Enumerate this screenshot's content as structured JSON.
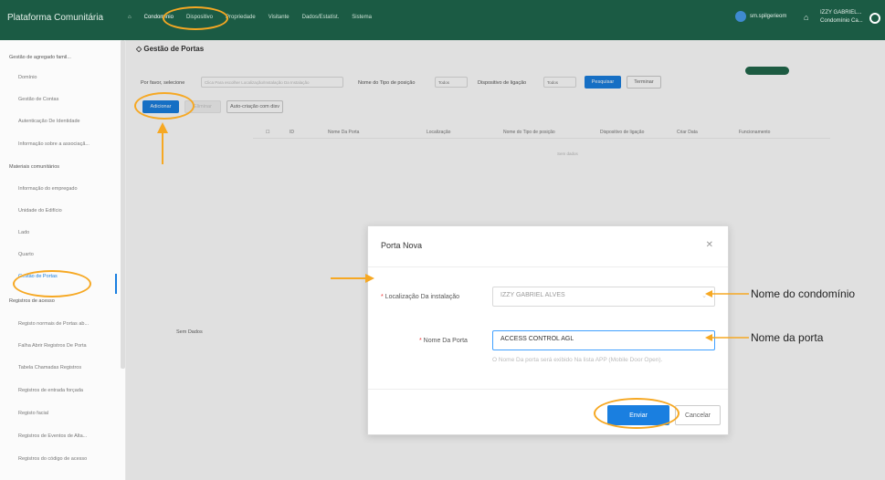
{
  "app": {
    "title": "Plataforma Comunitária"
  },
  "nav": [
    "Condomínio",
    "Dispositivo",
    "Propriedade",
    "Visitante",
    "Dados/Estatíst.",
    "Sistema"
  ],
  "user": {
    "name": "sm.spilgerieom",
    "profile_name": "IZZY GABRIEL...",
    "profile_sub": "Condomínio Ca..."
  },
  "sidebar": [
    {
      "type": "group",
      "label": "Gestão de agregado famil..."
    },
    {
      "type": "item",
      "label": "Domínio"
    },
    {
      "type": "item",
      "label": "Gestão de Contas"
    },
    {
      "type": "item",
      "label": "Autenticação De Identidade"
    },
    {
      "type": "item",
      "label": "Informação sobre a associaçã..."
    },
    {
      "type": "group",
      "label": "Materiais comunitários"
    },
    {
      "type": "item",
      "label": "Informação do empregado"
    },
    {
      "type": "item",
      "label": "Unidade do Edifício"
    },
    {
      "type": "item",
      "label": "Lado"
    },
    {
      "type": "item",
      "label": "Quarto"
    },
    {
      "type": "item",
      "label": "Gestão de Portas",
      "active": true
    },
    {
      "type": "group",
      "label": "Registros de acesso"
    },
    {
      "type": "item",
      "label": "Registo normais de Portas ab..."
    },
    {
      "type": "item",
      "label": "Falha Abrir Registros De Porta"
    },
    {
      "type": "item",
      "label": "Tabela Chamadas Registros"
    },
    {
      "type": "item",
      "label": "Registros de entrada forçada"
    },
    {
      "type": "item",
      "label": "Registo facial"
    },
    {
      "type": "item",
      "label": "Registros de Eventos de Alta..."
    },
    {
      "type": "item",
      "label": "Registros do código de acesso"
    }
  ],
  "page": {
    "title": "Gestão de Portas"
  },
  "filters": {
    "prompt": "Por favor, selecione",
    "placeholder": "Clica Para escolher Localização/Instalação Da Instalação",
    "type_label": "Nome do Tipo de posição",
    "type_value": "Todos",
    "device_label": "Dispositivo de ligação",
    "device_value": "Todos",
    "search": "Pesquisar",
    "reset": "Terminar"
  },
  "actions": {
    "add": "Adicionar",
    "delete": "Eliminar",
    "auto": "Auto-criação com disv"
  },
  "table": {
    "headers": [
      "ID",
      "Nome Da Porta",
      "Localização",
      "Nome do Tipo de posição",
      "Dispositivo de ligação",
      "Criar Data",
      "Funcionamento"
    ],
    "empty": "Sem dados",
    "empty_left": "Sem Dados"
  },
  "modal": {
    "title": "Porta Nova",
    "location_label": "Localização Da instalação",
    "location_value": "IZZY GABRIEL ALVES",
    "name_label": "Nome Da Porta",
    "name_value": "ACCESS CONTROL AGL",
    "hint": "O Nome Da porta será exibido Na lista APP (Mobile Door Open).",
    "submit": "Enviar",
    "cancel": "Cancelar"
  },
  "annotations": {
    "condo": "Nome do condomínio",
    "door": "Nome da porta"
  },
  "colors": {
    "topbar": "#1b5b44",
    "primary": "#1a7fe0",
    "highlight": "#f6a823"
  }
}
